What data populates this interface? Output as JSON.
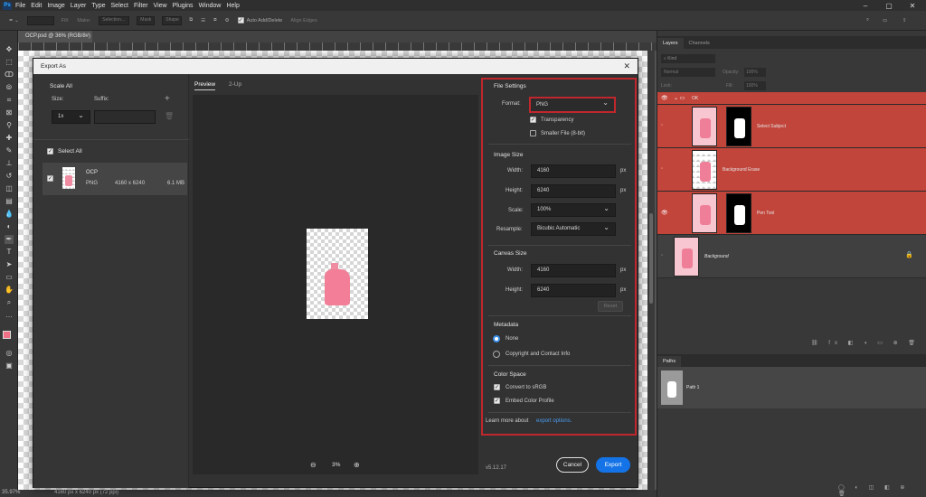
{
  "menu": [
    "File",
    "Edit",
    "Image",
    "Layer",
    "Type",
    "Select",
    "Filter",
    "View",
    "Plugins",
    "Window",
    "Help"
  ],
  "options": {
    "fill": "Fill:",
    "make": "Make:",
    "selection": "Selection...",
    "mask": "Mask",
    "shape": "Shape",
    "auto_add": "Auto Add/Delete",
    "align": "Align Edges"
  },
  "doc_tab": "OCP.psd @ 36% (RGB/8#)",
  "status": {
    "zoom": "35.97%",
    "info": "4160 px x 6240 px (72 ppi)"
  },
  "layers_panel": {
    "tabs": [
      "Layers",
      "Channels"
    ],
    "kind": "Kind",
    "blend": "Normal",
    "opacity_label": "Opacity:",
    "opacity": "100%",
    "lock_label": "Lock:",
    "fill_label": "Fill:",
    "fill": "100%",
    "group": "OK",
    "layers": [
      "Select Subject",
      "Background Erase",
      "Pen Tool",
      "Background"
    ]
  },
  "paths_panel": {
    "tab": "Paths",
    "path": "Path 1"
  },
  "dialog": {
    "title": "Export As",
    "scale_all": "Scale All",
    "size_label": "Size:",
    "suffix_label": "Suffix:",
    "size_value": "1x",
    "select_all": "Select All",
    "asset": {
      "name": "OCP",
      "format": "PNG",
      "dims": "4160 x 6240",
      "size": "6.1 MB"
    },
    "tabs": {
      "preview": "Preview",
      "two_up": "2-Up"
    },
    "zoom": "3%",
    "file_settings": {
      "heading": "File Settings",
      "format_label": "Format:",
      "format": "PNG",
      "transparency": "Transparency",
      "smaller": "Smaller File (8-bit)"
    },
    "image_size": {
      "heading": "Image Size",
      "width_label": "Width:",
      "width": "4160",
      "height_label": "Height:",
      "height": "6240",
      "scale_label": "Scale:",
      "scale": "100%",
      "resample_label": "Resample:",
      "resample": "Bicubic Automatic",
      "unit": "px"
    },
    "canvas_size": {
      "heading": "Canvas Size",
      "width_label": "Width:",
      "width": "4160",
      "height_label": "Height:",
      "height": "6240",
      "reset": "Reset",
      "unit": "px"
    },
    "metadata": {
      "heading": "Metadata",
      "none": "None",
      "copyright": "Copyright and Contact Info"
    },
    "color_space": {
      "heading": "Color Space",
      "srgb": "Convert to sRGB",
      "embed": "Embed Color Profile"
    },
    "learn": "Learn more about ",
    "learn_link": "export options.",
    "version": "v5.12.17",
    "cancel": "Cancel",
    "export": "Export"
  },
  "colors": {
    "highlight": "#c0272d",
    "accent": "#1473e6",
    "pink": "#f08ca2"
  }
}
